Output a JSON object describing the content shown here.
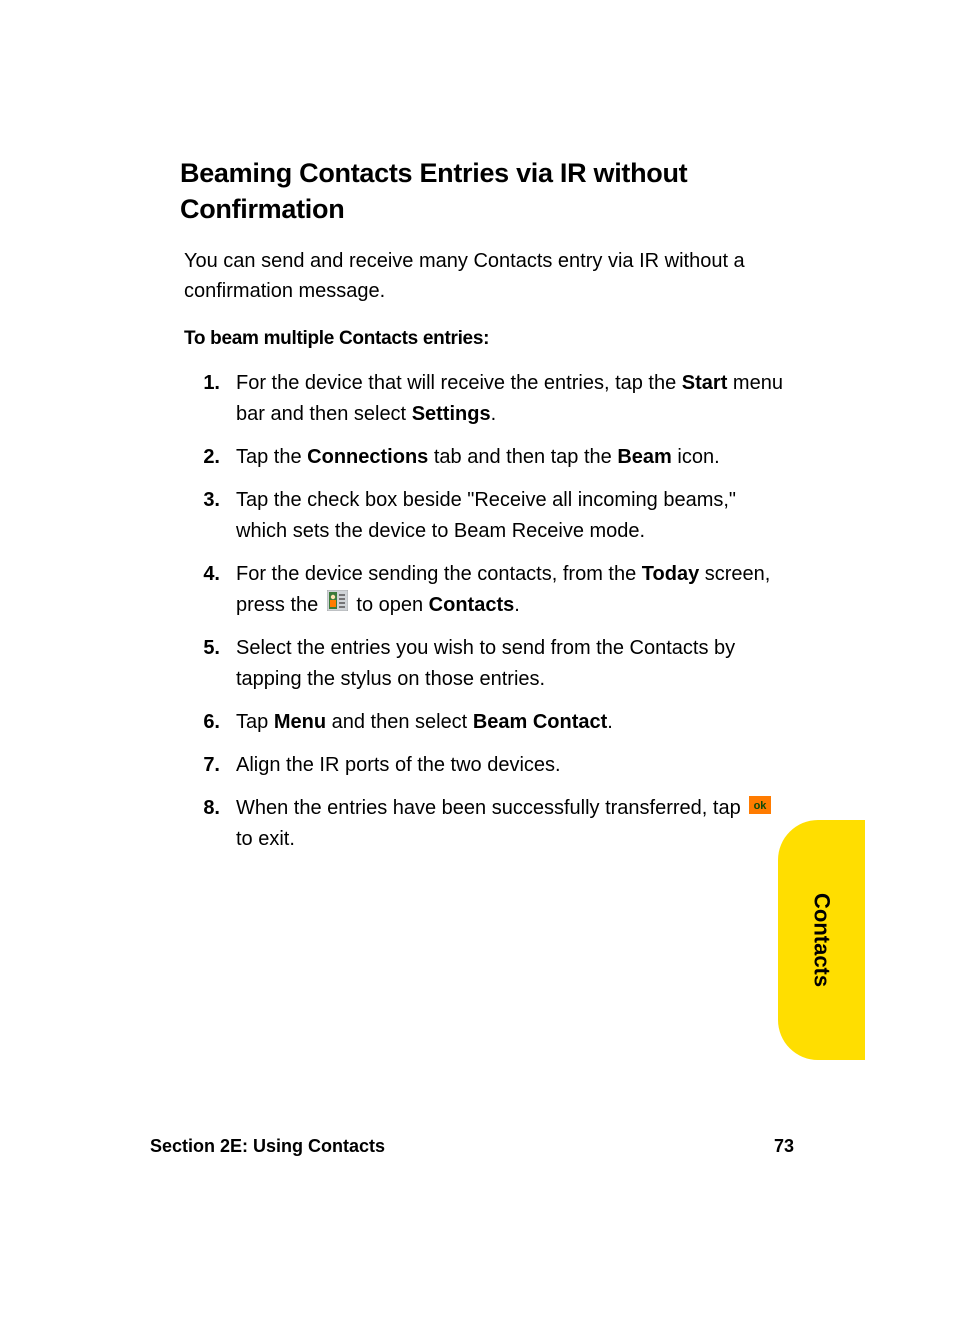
{
  "heading": "Beaming Contacts Entries via IR without Confirmation",
  "intro": "You can send and receive many Contacts entry via IR without a confirmation message.",
  "subhead": "To beam multiple Contacts entries:",
  "steps": {
    "s1": {
      "num": "1.",
      "pre": "For the device that will receive the entries, tap the ",
      "b1": "Start",
      "mid": " menu bar and then select ",
      "b2": "Settings",
      "post": "."
    },
    "s2": {
      "num": "2.",
      "pre": "Tap the ",
      "b1": "Connections",
      "mid": " tab and then tap the ",
      "b2": "Beam",
      "post": " icon."
    },
    "s3": {
      "num": "3.",
      "text": "Tap the check box beside \"Receive all incoming beams,\" which sets the device to Beam Receive mode."
    },
    "s4": {
      "num": "4.",
      "pre": "For the device sending the contacts, from the ",
      "b1": "Today",
      "mid": " screen, press the ",
      "mid2": " to open ",
      "b2": "Contacts",
      "post": "."
    },
    "s5": {
      "num": "5.",
      "text": "Select the entries you wish to send from the Contacts by tapping the stylus on those entries."
    },
    "s6": {
      "num": "6.",
      "pre": "Tap ",
      "b1": "Menu",
      "mid": " and then select ",
      "b2": "Beam Contact",
      "post": "."
    },
    "s7": {
      "num": "7.",
      "text": "Align the IR ports of the two devices."
    },
    "s8": {
      "num": "8.",
      "pre": " When the entries have been successfully transferred, tap ",
      "post": " to exit."
    }
  },
  "sidetab": "Contacts",
  "footer": {
    "left": "Section 2E: Using Contacts",
    "right": "73"
  }
}
